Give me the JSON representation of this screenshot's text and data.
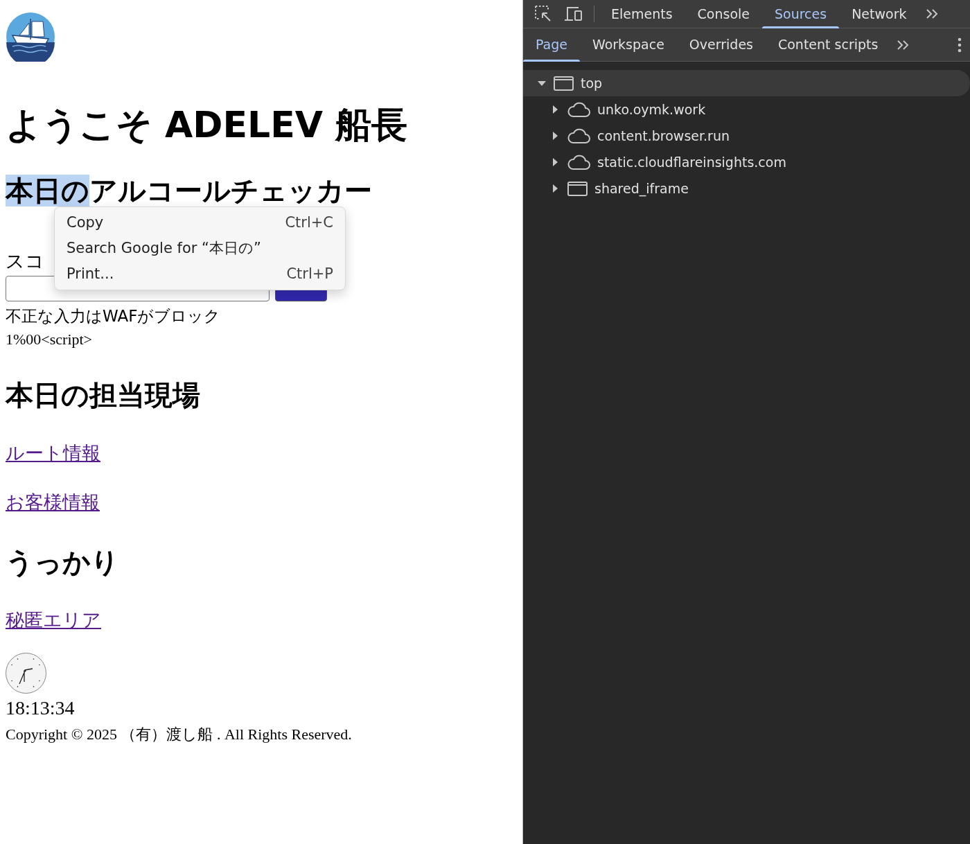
{
  "page": {
    "title": "ようこそ ADELEV 船長",
    "checker": {
      "heading_parts": [
        {
          "text": "本日の",
          "selected": true
        },
        {
          "text": "アルコールチェッカー",
          "selected": false
        }
      ],
      "score_label": "スコ",
      "note": "不正な入力はWAFがブロック",
      "output": "1%00<script>"
    },
    "sites_heading": "本日の担当現場",
    "site_links": [
      "ルート情報",
      "お客様情報"
    ],
    "oops_heading": "うっかり",
    "oops_links": [
      "秘匿エリア"
    ],
    "time": "18:13:34",
    "copyright": "Copyright © 2025 （有）渡し船 . All Rights Reserved."
  },
  "context_menu": [
    {
      "label": "Copy",
      "shortcut": "Ctrl+C"
    },
    {
      "label": "Search Google for “本日の”"
    },
    {
      "label": "Print...",
      "shortcut": "Ctrl+P"
    }
  ],
  "devtools": {
    "tabs": [
      {
        "label": "Elements",
        "selected": false
      },
      {
        "label": "Console",
        "selected": false
      },
      {
        "label": "Sources",
        "selected": true
      },
      {
        "label": "Network",
        "selected": false
      }
    ],
    "subtabs": [
      {
        "label": "Page",
        "selected": true
      },
      {
        "label": "Workspace",
        "selected": false
      },
      {
        "label": "Overrides",
        "selected": false
      },
      {
        "label": "Content scripts",
        "selected": false
      }
    ],
    "tree": [
      {
        "label": "top",
        "kind": "frame",
        "expanded": true,
        "children": [
          {
            "label": "unko.oymk.work",
            "kind": "origin",
            "expanded": false
          },
          {
            "label": "content.browser.run",
            "kind": "origin",
            "expanded": false
          },
          {
            "label": "static.cloudflareinsights.com",
            "kind": "origin",
            "expanded": false
          },
          {
            "label": "shared_iframe",
            "kind": "frame",
            "expanded": false
          }
        ]
      }
    ]
  }
}
